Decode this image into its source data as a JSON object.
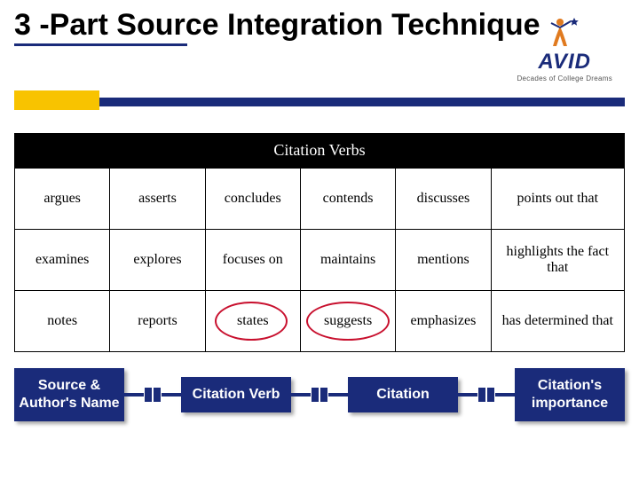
{
  "title": "3 -Part Source Integration Technique",
  "logo": {
    "brand": "AVID",
    "tagline": "Decades of College Dreams"
  },
  "table": {
    "header": "Citation Verbs",
    "rows": [
      [
        "argues",
        "asserts",
        "concludes",
        "contends",
        "discusses",
        "points out that"
      ],
      [
        "examines",
        "explores",
        "focuses on",
        "maintains",
        "mentions",
        "highlights the fact that"
      ],
      [
        "notes",
        "reports",
        "states",
        "suggests",
        "emphasizes",
        "has determined that"
      ]
    ],
    "circled": [
      {
        "row": 2,
        "col": 2
      },
      {
        "row": 2,
        "col": 3
      }
    ]
  },
  "flow": {
    "boxes": [
      "Source & Author's Name",
      "Citation Verb",
      "Citation",
      "Citation's importance"
    ]
  }
}
